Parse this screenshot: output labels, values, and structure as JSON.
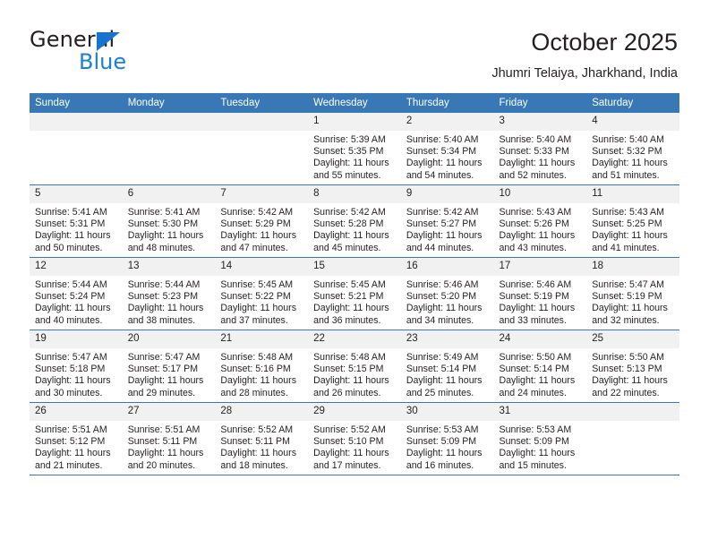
{
  "brand": {
    "name_top": "General",
    "name_bottom": "Blue",
    "accent_color": "#1b7fd4"
  },
  "header": {
    "title": "October 2025",
    "subtitle": "Jhumri Telaiya, Jharkhand, India"
  },
  "calendar": {
    "header_bg": "#3878b4",
    "daynum_bg": "#f1f1f1",
    "weekday_labels": [
      "Sunday",
      "Monday",
      "Tuesday",
      "Wednesday",
      "Thursday",
      "Friday",
      "Saturday"
    ],
    "weeks": [
      [
        {
          "day": ""
        },
        {
          "day": ""
        },
        {
          "day": ""
        },
        {
          "day": "1",
          "sunrise": "Sunrise: 5:39 AM",
          "sunset": "Sunset: 5:35 PM",
          "daylight1": "Daylight: 11 hours",
          "daylight2": "and 55 minutes."
        },
        {
          "day": "2",
          "sunrise": "Sunrise: 5:40 AM",
          "sunset": "Sunset: 5:34 PM",
          "daylight1": "Daylight: 11 hours",
          "daylight2": "and 54 minutes."
        },
        {
          "day": "3",
          "sunrise": "Sunrise: 5:40 AM",
          "sunset": "Sunset: 5:33 PM",
          "daylight1": "Daylight: 11 hours",
          "daylight2": "and 52 minutes."
        },
        {
          "day": "4",
          "sunrise": "Sunrise: 5:40 AM",
          "sunset": "Sunset: 5:32 PM",
          "daylight1": "Daylight: 11 hours",
          "daylight2": "and 51 minutes."
        }
      ],
      [
        {
          "day": "5",
          "sunrise": "Sunrise: 5:41 AM",
          "sunset": "Sunset: 5:31 PM",
          "daylight1": "Daylight: 11 hours",
          "daylight2": "and 50 minutes."
        },
        {
          "day": "6",
          "sunrise": "Sunrise: 5:41 AM",
          "sunset": "Sunset: 5:30 PM",
          "daylight1": "Daylight: 11 hours",
          "daylight2": "and 48 minutes."
        },
        {
          "day": "7",
          "sunrise": "Sunrise: 5:42 AM",
          "sunset": "Sunset: 5:29 PM",
          "daylight1": "Daylight: 11 hours",
          "daylight2": "and 47 minutes."
        },
        {
          "day": "8",
          "sunrise": "Sunrise: 5:42 AM",
          "sunset": "Sunset: 5:28 PM",
          "daylight1": "Daylight: 11 hours",
          "daylight2": "and 45 minutes."
        },
        {
          "day": "9",
          "sunrise": "Sunrise: 5:42 AM",
          "sunset": "Sunset: 5:27 PM",
          "daylight1": "Daylight: 11 hours",
          "daylight2": "and 44 minutes."
        },
        {
          "day": "10",
          "sunrise": "Sunrise: 5:43 AM",
          "sunset": "Sunset: 5:26 PM",
          "daylight1": "Daylight: 11 hours",
          "daylight2": "and 43 minutes."
        },
        {
          "day": "11",
          "sunrise": "Sunrise: 5:43 AM",
          "sunset": "Sunset: 5:25 PM",
          "daylight1": "Daylight: 11 hours",
          "daylight2": "and 41 minutes."
        }
      ],
      [
        {
          "day": "12",
          "sunrise": "Sunrise: 5:44 AM",
          "sunset": "Sunset: 5:24 PM",
          "daylight1": "Daylight: 11 hours",
          "daylight2": "and 40 minutes."
        },
        {
          "day": "13",
          "sunrise": "Sunrise: 5:44 AM",
          "sunset": "Sunset: 5:23 PM",
          "daylight1": "Daylight: 11 hours",
          "daylight2": "and 38 minutes."
        },
        {
          "day": "14",
          "sunrise": "Sunrise: 5:45 AM",
          "sunset": "Sunset: 5:22 PM",
          "daylight1": "Daylight: 11 hours",
          "daylight2": "and 37 minutes."
        },
        {
          "day": "15",
          "sunrise": "Sunrise: 5:45 AM",
          "sunset": "Sunset: 5:21 PM",
          "daylight1": "Daylight: 11 hours",
          "daylight2": "and 36 minutes."
        },
        {
          "day": "16",
          "sunrise": "Sunrise: 5:46 AM",
          "sunset": "Sunset: 5:20 PM",
          "daylight1": "Daylight: 11 hours",
          "daylight2": "and 34 minutes."
        },
        {
          "day": "17",
          "sunrise": "Sunrise: 5:46 AM",
          "sunset": "Sunset: 5:19 PM",
          "daylight1": "Daylight: 11 hours",
          "daylight2": "and 33 minutes."
        },
        {
          "day": "18",
          "sunrise": "Sunrise: 5:47 AM",
          "sunset": "Sunset: 5:19 PM",
          "daylight1": "Daylight: 11 hours",
          "daylight2": "and 32 minutes."
        }
      ],
      [
        {
          "day": "19",
          "sunrise": "Sunrise: 5:47 AM",
          "sunset": "Sunset: 5:18 PM",
          "daylight1": "Daylight: 11 hours",
          "daylight2": "and 30 minutes."
        },
        {
          "day": "20",
          "sunrise": "Sunrise: 5:47 AM",
          "sunset": "Sunset: 5:17 PM",
          "daylight1": "Daylight: 11 hours",
          "daylight2": "and 29 minutes."
        },
        {
          "day": "21",
          "sunrise": "Sunrise: 5:48 AM",
          "sunset": "Sunset: 5:16 PM",
          "daylight1": "Daylight: 11 hours",
          "daylight2": "and 28 minutes."
        },
        {
          "day": "22",
          "sunrise": "Sunrise: 5:48 AM",
          "sunset": "Sunset: 5:15 PM",
          "daylight1": "Daylight: 11 hours",
          "daylight2": "and 26 minutes."
        },
        {
          "day": "23",
          "sunrise": "Sunrise: 5:49 AM",
          "sunset": "Sunset: 5:14 PM",
          "daylight1": "Daylight: 11 hours",
          "daylight2": "and 25 minutes."
        },
        {
          "day": "24",
          "sunrise": "Sunrise: 5:50 AM",
          "sunset": "Sunset: 5:14 PM",
          "daylight1": "Daylight: 11 hours",
          "daylight2": "and 24 minutes."
        },
        {
          "day": "25",
          "sunrise": "Sunrise: 5:50 AM",
          "sunset": "Sunset: 5:13 PM",
          "daylight1": "Daylight: 11 hours",
          "daylight2": "and 22 minutes."
        }
      ],
      [
        {
          "day": "26",
          "sunrise": "Sunrise: 5:51 AM",
          "sunset": "Sunset: 5:12 PM",
          "daylight1": "Daylight: 11 hours",
          "daylight2": "and 21 minutes."
        },
        {
          "day": "27",
          "sunrise": "Sunrise: 5:51 AM",
          "sunset": "Sunset: 5:11 PM",
          "daylight1": "Daylight: 11 hours",
          "daylight2": "and 20 minutes."
        },
        {
          "day": "28",
          "sunrise": "Sunrise: 5:52 AM",
          "sunset": "Sunset: 5:11 PM",
          "daylight1": "Daylight: 11 hours",
          "daylight2": "and 18 minutes."
        },
        {
          "day": "29",
          "sunrise": "Sunrise: 5:52 AM",
          "sunset": "Sunset: 5:10 PM",
          "daylight1": "Daylight: 11 hours",
          "daylight2": "and 17 minutes."
        },
        {
          "day": "30",
          "sunrise": "Sunrise: 5:53 AM",
          "sunset": "Sunset: 5:09 PM",
          "daylight1": "Daylight: 11 hours",
          "daylight2": "and 16 minutes."
        },
        {
          "day": "31",
          "sunrise": "Sunrise: 5:53 AM",
          "sunset": "Sunset: 5:09 PM",
          "daylight1": "Daylight: 11 hours",
          "daylight2": "and 15 minutes."
        },
        {
          "day": ""
        }
      ]
    ]
  }
}
